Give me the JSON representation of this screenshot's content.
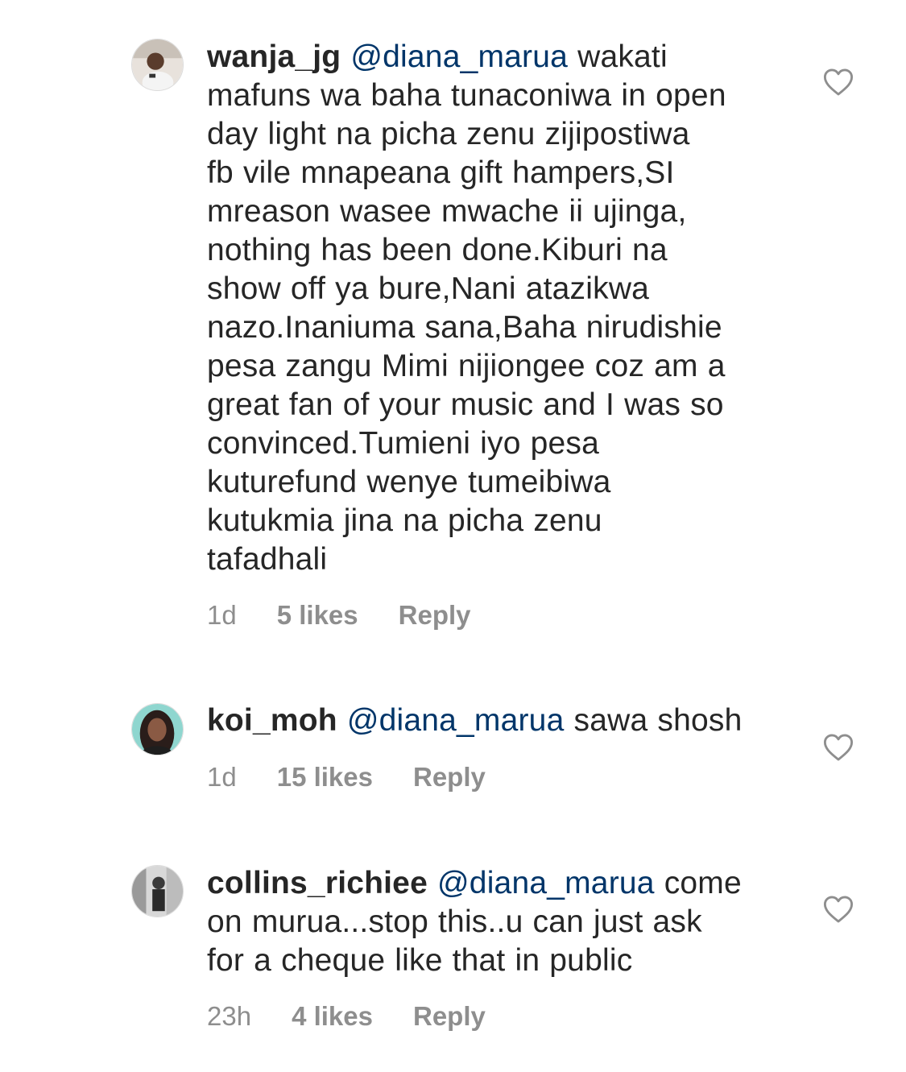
{
  "comments": [
    {
      "username": "wanja_jg",
      "mention": "@diana_marua",
      "lines": [
        "wakati",
        "mafuns wa baha tunaconiwa in open",
        "day light na picha zenu zijipostiwa",
        "fb vile mnapeana gift hampers,SI",
        "mreason wasee mwache ii ujinga,",
        "nothing has been done.Kiburi na",
        "show off ya bure,Nani atazikwa",
        "nazo.Inaniuma sana,Baha nirudishie",
        "pesa zangu Mimi nijiongee coz am a",
        "great fan of your music and I was so",
        "convinced.Tumieni iyo pesa",
        "kuturefund wenye tumeibiwa",
        "kutukmia jina na picha zenu",
        "tafadhali"
      ],
      "time": "1d",
      "likes": "5 likes",
      "reply": "Reply",
      "avatar_icon": "user-avatar-icon",
      "like_icon": "heart-outline-icon"
    },
    {
      "username": "koi_moh",
      "mention": "@diana_marua",
      "lines": [
        "sawa shosh"
      ],
      "time": "1d",
      "likes": "15 likes",
      "reply": "Reply",
      "avatar_icon": "user-avatar-icon",
      "like_icon": "heart-outline-icon"
    },
    {
      "username": "collins_richiee",
      "mention": "@diana_marua",
      "lines": [
        "come",
        "on murua...stop this..u can just ask",
        "for a cheque like that in public"
      ],
      "time": "23h",
      "likes": "4 likes",
      "reply": "Reply",
      "avatar_icon": "user-avatar-icon",
      "like_icon": "heart-outline-icon"
    }
  ],
  "colors": {
    "text": "#262626",
    "mention": "#003569",
    "meta": "#8e8e8e",
    "heart": "#8e8e8e"
  }
}
